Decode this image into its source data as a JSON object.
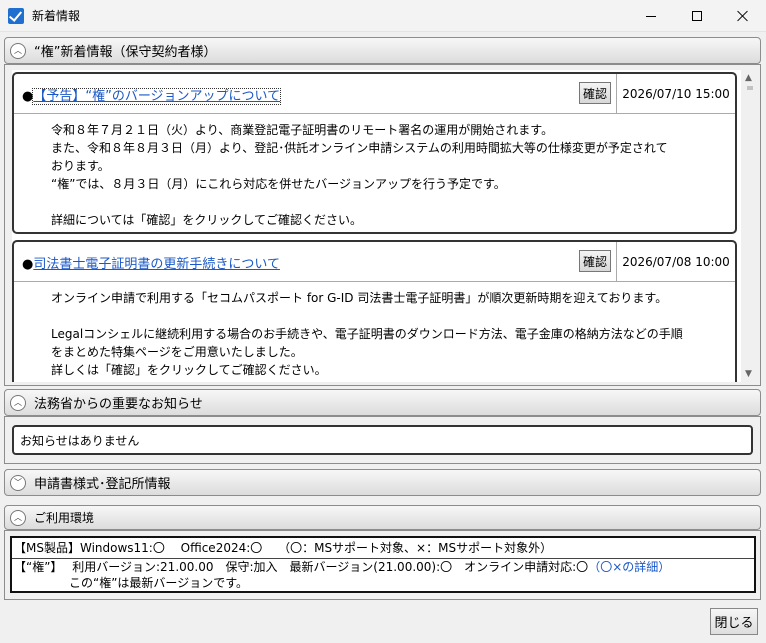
{
  "window": {
    "title": "新着情報"
  },
  "sections": {
    "news": {
      "label": "“権”新着情報（保守契約者様）"
    },
    "ministry": {
      "label": "法務省からの重要なお知らせ",
      "notice": "お知らせはありません"
    },
    "forms": {
      "label": "申請書様式･登記所情報"
    },
    "env": {
      "label": "ご利用環境"
    }
  },
  "news_items": [
    {
      "bullet": "●",
      "title": "【予告】“権”のバージョンアップについて",
      "confirm_label": "確認",
      "date": "2026/07/10 15:00",
      "body": "令和８年７月２１日（火）より、商業登記電子証明書のリモート署名の運用が開始されます。\nまた、令和８年８月３日（月）より、登記･供託オンライン申請システムの利用時間拡大等の仕様変更が予定されて\nおります。\n“権”では、８月３日（月）にこれら対応を併せたバージョンアップを行う予定です。\n\n詳細については「確認」をクリックしてご確認ください。"
    },
    {
      "bullet": "●",
      "title": "司法書士電子証明書の更新手続きについて",
      "confirm_label": "確認",
      "date": "2026/07/08 10:00",
      "body": "オンライン申請で利用する「セコムパスポート for G-ID 司法書士電子証明書」が順次更新時期を迎えております。\n\nLegalコンシェルに継続利用する場合のお手続きや、電子証明書のダウンロード方法、電子金庫の格納方法などの手順\nをまとめた特集ページをご用意いたしました。\n詳しくは「確認」をクリックしてご確認ください。"
    }
  ],
  "environment": {
    "ms_line": "【MS製品】Windows11:〇　 Office2024:〇　 （〇：MSサポート対象、×：MSサポート対象外）",
    "ken_line": "【“権”】　 利用バージョン:21.00.00　保守:加入　最新バージョン(21.00.00):〇　オンライン申請対応:〇",
    "ken_link": "（〇×の詳細）",
    "latest_line": "この“権”は最新バージョンです。"
  },
  "footer": {
    "close_label": "閉じる"
  },
  "colors": {
    "link": "#1a58c7"
  }
}
